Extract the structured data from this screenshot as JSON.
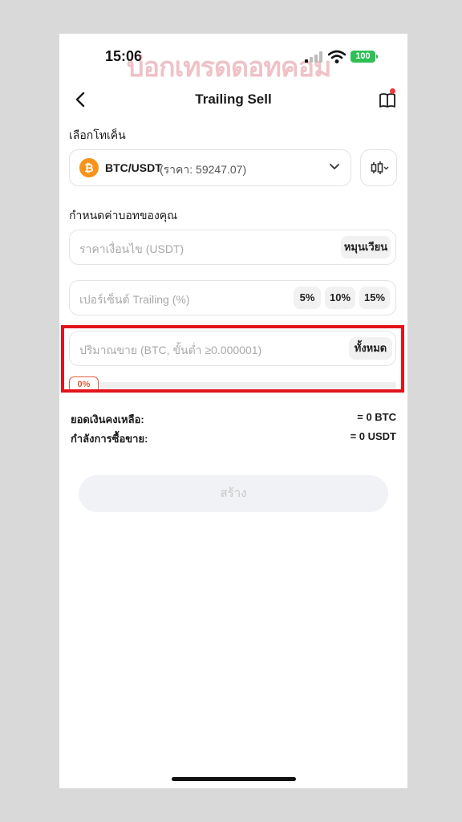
{
  "status_bar": {
    "time": "15:06",
    "battery": "100"
  },
  "watermark": "บ่อกเทรดดอทคอม",
  "header": {
    "title": "Trailing Sell"
  },
  "token_section": {
    "label": "เลือกโทเค็น",
    "pair": "BTC/USDT",
    "price_text": "(ราคา: 59247.07)",
    "coin_symbol": "₿"
  },
  "bot_section": {
    "label": "กำหนดค่าบอทของคุณ",
    "trigger_price": {
      "placeholder": "ราคาเงื่อนไข (USDT)",
      "button": "หมุนเวียน"
    },
    "trailing": {
      "placeholder": "เปอร์เซ็นต์ Trailing (%)",
      "presets": [
        "5%",
        "10%",
        "15%"
      ]
    },
    "amount": {
      "placeholder": "ปริมาณขาย  (BTC, ขั้นต่ำ ≥0.000001)",
      "button": "ทั้งหมด"
    },
    "slider_value": "0%"
  },
  "info": {
    "balance_label": "ยอดเงินคงเหลือ:",
    "balance_value": "= 0 BTC",
    "power_label": "กำลังการซื้อขาย:",
    "power_value": "= 0 USDT"
  },
  "create_button": "สร้าง",
  "colors": {
    "accent": "#e55c36",
    "highlight": "#e4141b",
    "bitcoin": "#f7931a",
    "battery": "#2fbf55"
  }
}
